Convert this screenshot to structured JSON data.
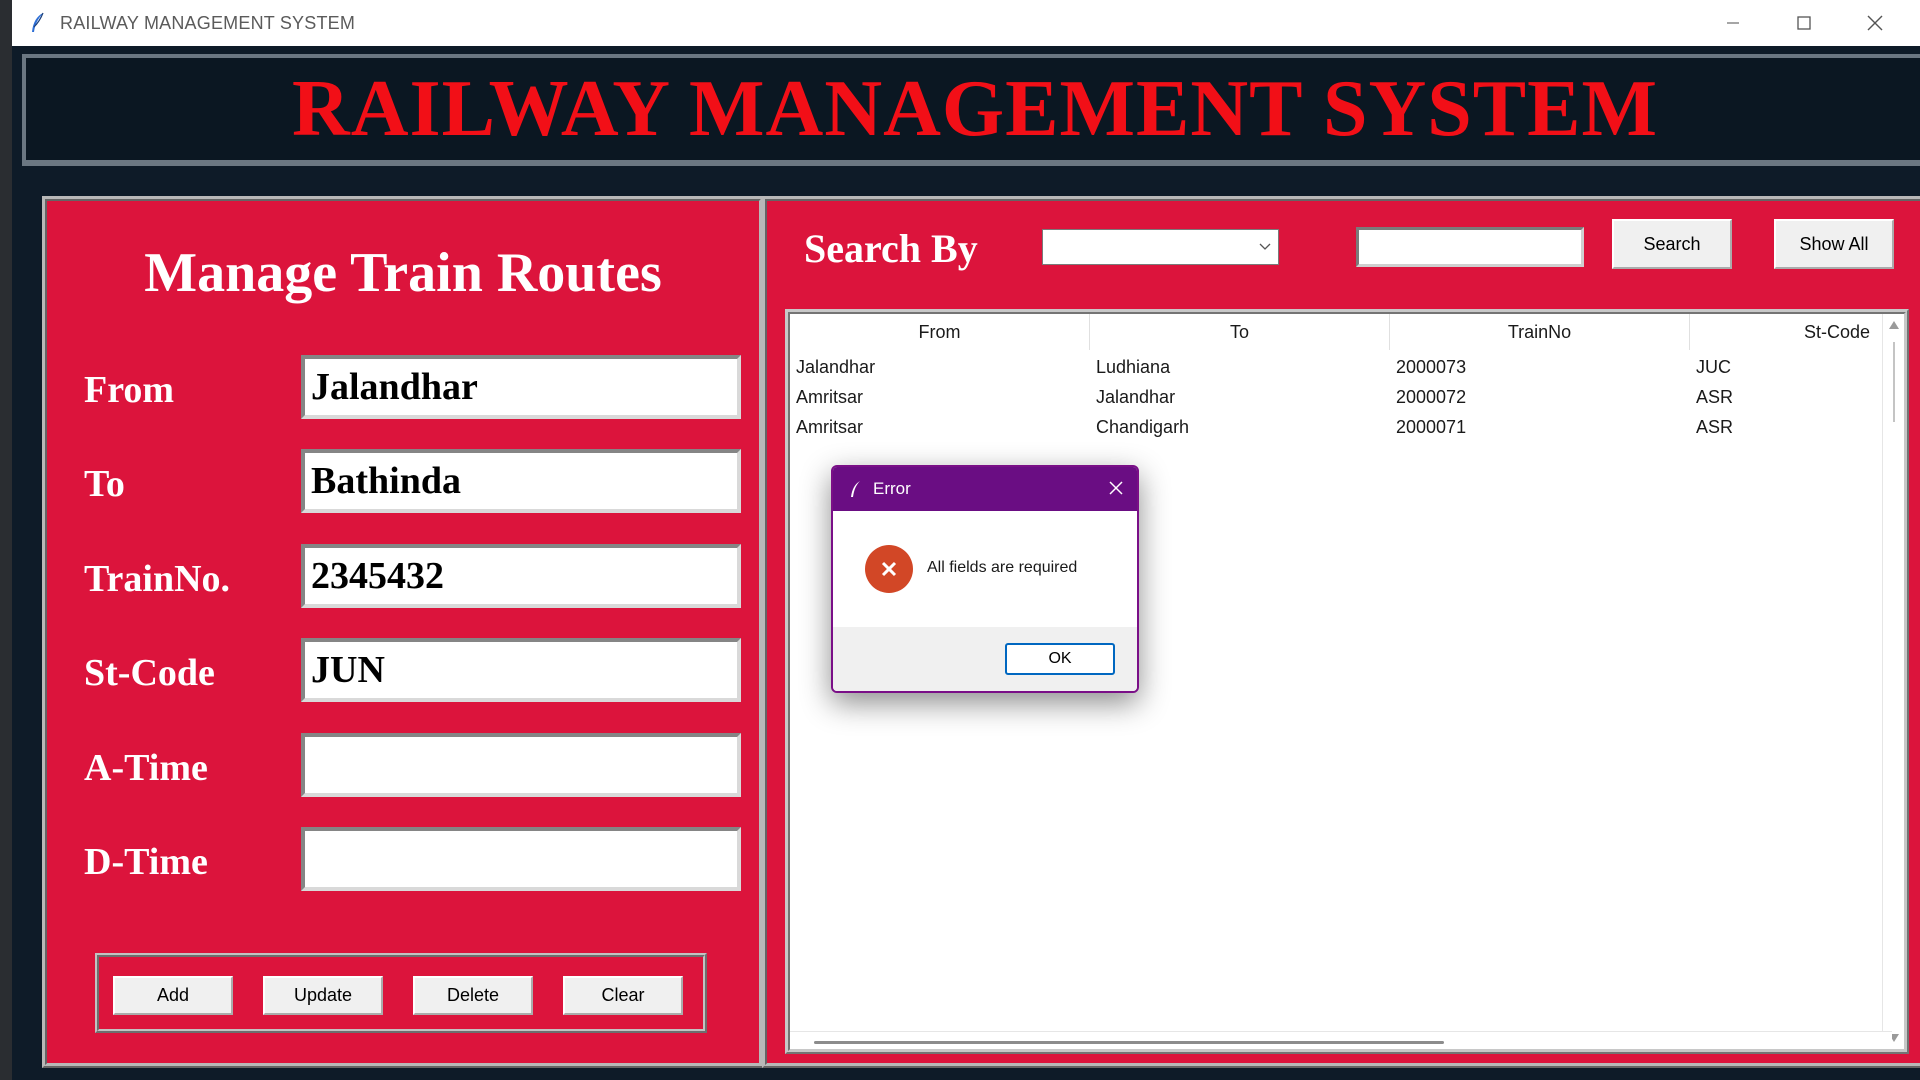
{
  "window": {
    "title": "RAILWAY MANAGEMENT SYSTEM",
    "controls": [
      "minimize-icon",
      "maximize-icon",
      "close-icon"
    ]
  },
  "header": {
    "title": "RAILWAY MANAGEMENT SYSTEM",
    "color": "#f20f17"
  },
  "form": {
    "title": "Manage Train Routes",
    "fields": [
      {
        "label": "From",
        "value": "Jalandhar"
      },
      {
        "label": "To",
        "value": "Bathinda"
      },
      {
        "label": "TrainNo.",
        "value": "2345432"
      },
      {
        "label": "St-Code",
        "value": "JUN"
      },
      {
        "label": "A-Time",
        "value": ""
      },
      {
        "label": "D-Time",
        "value": ""
      }
    ],
    "buttons": {
      "add": "Add",
      "update": "Update",
      "delete": "Delete",
      "clear": "Clear"
    }
  },
  "search": {
    "label": "Search By",
    "combo_value": "",
    "entry_value": "",
    "search_button": "Search",
    "show_all_button": "Show All"
  },
  "table": {
    "columns": [
      "From",
      "To",
      "TrainNo",
      "St-Code"
    ],
    "rows": [
      [
        "Jalandhar",
        "Ludhiana",
        "2000073",
        "JUC"
      ],
      [
        "Amritsar",
        "Jalandhar",
        "2000072",
        "ASR"
      ],
      [
        "Amritsar",
        "Chandigarh",
        "2000071",
        "ASR"
      ]
    ]
  },
  "dialog": {
    "title": "Error",
    "message": "All fields are required",
    "ok_label": "OK",
    "icon": "error-icon",
    "title_color": "#6a0d83"
  },
  "colors": {
    "panel": "#dc143c",
    "background": "#0e1b28"
  }
}
